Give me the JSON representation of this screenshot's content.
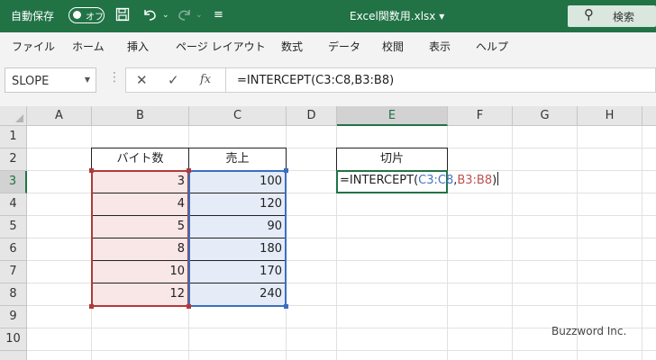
{
  "titlebar": {
    "autosave_label": "自動保存",
    "autosave_state": "オフ",
    "filename": "Excel関数用.xlsx ▾",
    "search_label": "検索",
    "accent": "#217346"
  },
  "tabs": [
    "ファイル",
    "ホーム",
    "挿入",
    "ページ レイアウト",
    "数式",
    "データ",
    "校閲",
    "表示",
    "ヘルプ"
  ],
  "formula_bar": {
    "name_box": "SLOPE",
    "cancel": "✕",
    "enter": "✓",
    "fx": "fx",
    "formula": "=INTERCEPT(C3:C8,B3:B8)"
  },
  "sheet": {
    "columns": [
      "A",
      "B",
      "C",
      "D",
      "E",
      "F",
      "G",
      "H"
    ],
    "rows": [
      "1",
      "2",
      "3",
      "4",
      "5",
      "6",
      "7",
      "8",
      "9",
      "10"
    ],
    "header_b": "バイト数",
    "header_c": "売上",
    "b_values": [
      "3",
      "4",
      "5",
      "8",
      "10",
      "12"
    ],
    "c_values": [
      "100",
      "120",
      "90",
      "180",
      "170",
      "240"
    ],
    "header_e": "切片",
    "edit": {
      "prefix": "=INTERCEPT(",
      "ref1": "C3:C8",
      "comma": ",",
      "ref2": "B3:B8",
      "suffix": ")"
    }
  },
  "watermark": "Buzzword Inc."
}
